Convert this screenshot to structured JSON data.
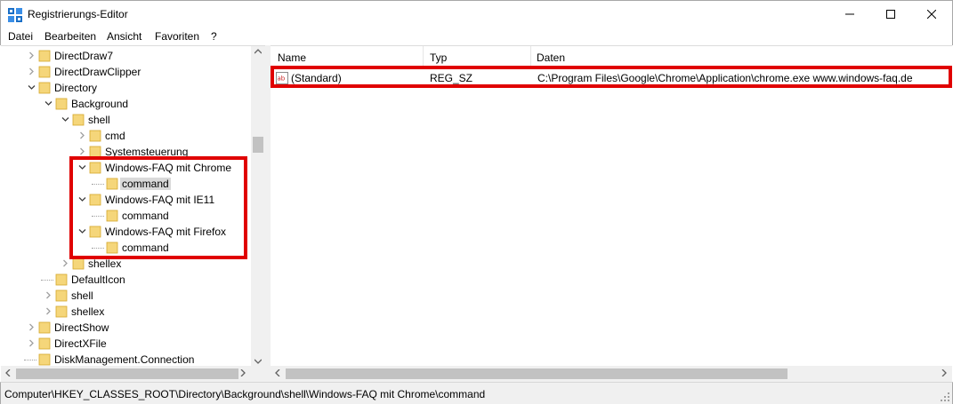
{
  "window": {
    "title": "Registrierungs-Editor",
    "icon": "regedit-icon"
  },
  "menu": [
    {
      "label": "Datei"
    },
    {
      "label": "Bearbeiten"
    },
    {
      "label": "Ansicht"
    },
    {
      "label": "Favoriten"
    },
    {
      "label": "?"
    }
  ],
  "tree": [
    {
      "label": "DirectDraw7",
      "depth": 0,
      "expander": "collapsed"
    },
    {
      "label": "DirectDrawClipper",
      "depth": 0,
      "expander": "collapsed"
    },
    {
      "label": "Directory",
      "depth": 0,
      "expander": "expanded"
    },
    {
      "label": "Background",
      "depth": 1,
      "expander": "expanded"
    },
    {
      "label": "shell",
      "depth": 2,
      "expander": "expanded"
    },
    {
      "label": "cmd",
      "depth": 3,
      "expander": "collapsed"
    },
    {
      "label": "Systemsteuerung",
      "depth": 3,
      "expander": "collapsed"
    },
    {
      "label": "Windows-FAQ mit Chrome",
      "depth": 3,
      "expander": "expanded"
    },
    {
      "label": "command",
      "depth": 4,
      "expander": "none",
      "selected": true
    },
    {
      "label": "Windows-FAQ mit IE11",
      "depth": 3,
      "expander": "expanded"
    },
    {
      "label": "command",
      "depth": 4,
      "expander": "none"
    },
    {
      "label": "Windows-FAQ mit Firefox",
      "depth": 3,
      "expander": "expanded"
    },
    {
      "label": "command",
      "depth": 4,
      "expander": "none"
    },
    {
      "label": "shellex",
      "depth": 2,
      "expander": "collapsed"
    },
    {
      "label": "DefaultIcon",
      "depth": 1,
      "expander": "none"
    },
    {
      "label": "shell",
      "depth": 1,
      "expander": "collapsed"
    },
    {
      "label": "shellex",
      "depth": 1,
      "expander": "collapsed"
    },
    {
      "label": "DirectShow",
      "depth": 0,
      "expander": "collapsed"
    },
    {
      "label": "DirectXFile",
      "depth": 0,
      "expander": "collapsed"
    },
    {
      "label": "DiskManagement.Connection",
      "depth": 0,
      "expander": "none"
    }
  ],
  "list": {
    "columns": [
      {
        "label": "Name"
      },
      {
        "label": "Typ"
      },
      {
        "label": "Daten"
      }
    ],
    "rows": [
      {
        "icon": "reg-sz-icon",
        "name": "(Standard)",
        "type": "REG_SZ",
        "data": "C:\\Program Files\\Google\\Chrome\\Application\\chrome.exe www.windows-faq.de"
      }
    ]
  },
  "status": {
    "path": "Computer\\HKEY_CLASSES_ROOT\\Directory\\Background\\shell\\Windows-FAQ mit Chrome\\command"
  },
  "colors": {
    "folder": "#f5d67a",
    "folder_edge": "#d4a72c",
    "highlight": "#e00000",
    "selection": "#d9d9d9",
    "icon_blue": "#1a6fc7"
  }
}
